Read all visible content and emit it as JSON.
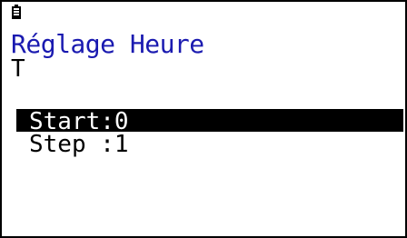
{
  "screen": {
    "title": "Réglage Heure",
    "variable": "T",
    "icons": {
      "status": "battery-icon"
    },
    "colors": {
      "title": "#1a1ab0",
      "selection_bg": "#000000",
      "selection_fg": "#ffffff"
    }
  },
  "menu": {
    "items": [
      {
        "label": "Start:0",
        "selected": true
      },
      {
        "label": "Step :1",
        "selected": false
      }
    ]
  }
}
